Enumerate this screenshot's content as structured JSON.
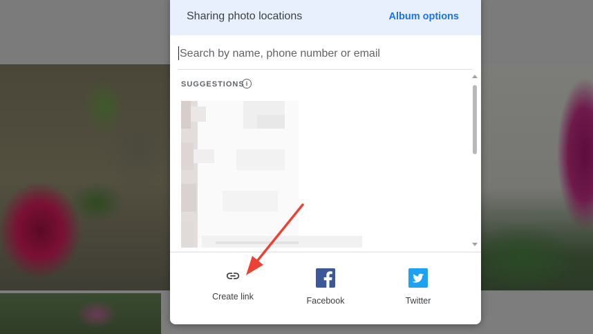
{
  "dialog": {
    "title": "Sharing photo locations",
    "album_options_label": "Album options",
    "search": {
      "placeholder": "Search by name, phone number or email",
      "value": ""
    },
    "suggestions_label": "SUGGESTIONS",
    "info_icon": "info-icon"
  },
  "share": {
    "items": [
      {
        "label": "Create link",
        "icon": "link-icon"
      },
      {
        "label": "Facebook",
        "icon": "facebook-icon",
        "color": "#3b5998"
      },
      {
        "label": "Twitter",
        "icon": "twitter-icon",
        "color": "#1da1f2"
      }
    ]
  },
  "colors": {
    "accent": "#1a73e8",
    "header_bg": "#e8f0fe",
    "annotation_arrow": "#ea4335"
  }
}
